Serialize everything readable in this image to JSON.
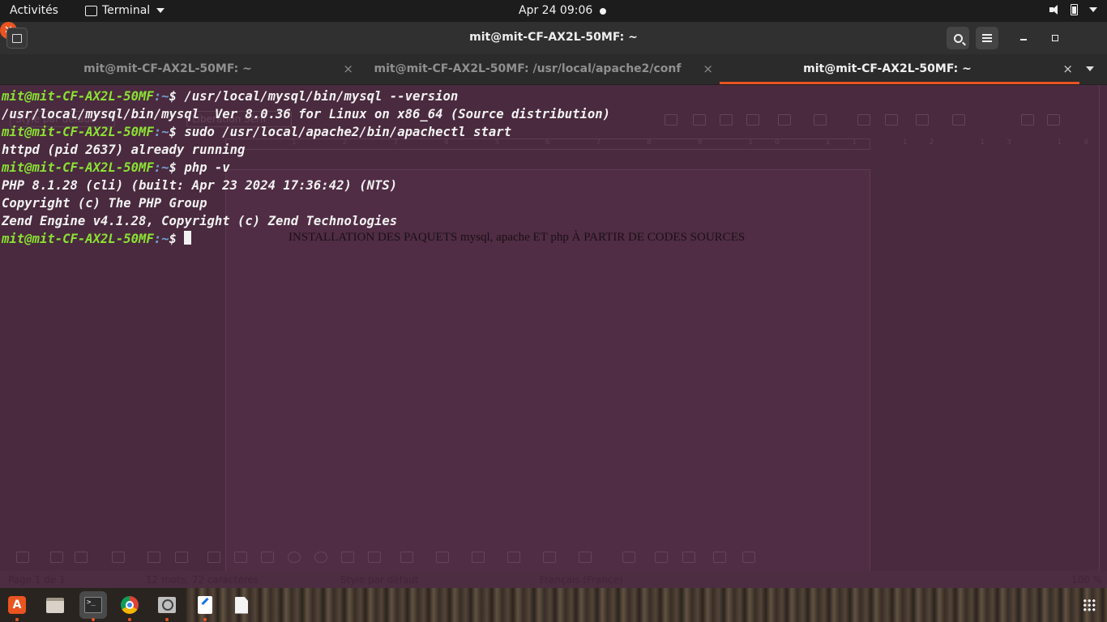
{
  "topbar": {
    "activities": "Activités",
    "app_name": "Terminal",
    "clock": "Apr 24  09:06",
    "icons": [
      "terminal-icon",
      "volume-icon",
      "battery-icon",
      "system-menu-caret-icon"
    ]
  },
  "window": {
    "title": "mit@mit-CF-AX2L-50MF: ~",
    "close_glyph": "✕"
  },
  "tabs": [
    {
      "label": "mit@mit-CF-AX2L-50MF: ~",
      "active": false
    },
    {
      "label": "mit@mit-CF-AX2L-50MF: /usr/local/apache2/conf",
      "active": false
    },
    {
      "label": "mit@mit-CF-AX2L-50MF: ~",
      "active": true
    }
  ],
  "tab_close_glyph": "×",
  "terminal": {
    "prompt_user": "mit@mit-CF-AX2L-50MF",
    "prompt_path": ":~",
    "prompt_symbol": "$ ",
    "lines": [
      {
        "cmd": "/usr/local/mysql/bin/mysql --version"
      },
      {
        "out": "/usr/local/mysql/bin/mysql  Ver 8.0.36 for Linux on x86_64 (Source distribution)"
      },
      {
        "cmd": "sudo /usr/local/apache2/bin/apachectl start"
      },
      {
        "out": "httpd (pid 2637) already running"
      },
      {
        "cmd": "php -v"
      },
      {
        "out": "PHP 8.1.28 (cli) (built: Apr 23 2024 17:36:42) (NTS)"
      },
      {
        "out": "Copyright (c) The PHP Group"
      },
      {
        "out": "Zend Engine v4.1.28, Copyright (c) Zend Technologies"
      },
      {
        "cmd": ""
      }
    ]
  },
  "background_document": {
    "paragraph_style": "Style par défaut",
    "font_name": "Liberation Serif",
    "ruler_numbers": "1 2 3 4 5 6 7 8 9 10 11 12 13 14 15 16 17 18",
    "text": "INSTALLATION DES PAQUETS mysql, apache ET php  À PARTIR DE CODES SOURCES",
    "status": {
      "page": "Page 1 de 1",
      "words": "12 mots, 72 caractères",
      "style": "Style par défaut",
      "language": "Français (France)",
      "zoom": "100 %"
    }
  },
  "colors": {
    "accent": "#e95420",
    "prompt_user": "#8ae234",
    "prompt_path": "#729fcf",
    "terminal_bg": "#4a2a3e"
  },
  "dock": {
    "items": [
      "ubuntu-software-icon",
      "files-icon",
      "terminal-icon",
      "chrome-icon",
      "image-viewer-icon",
      "text-editor-writer-icon",
      "text-document-icon"
    ],
    "terminal_glyph": ">_",
    "store_glyph": "A"
  }
}
